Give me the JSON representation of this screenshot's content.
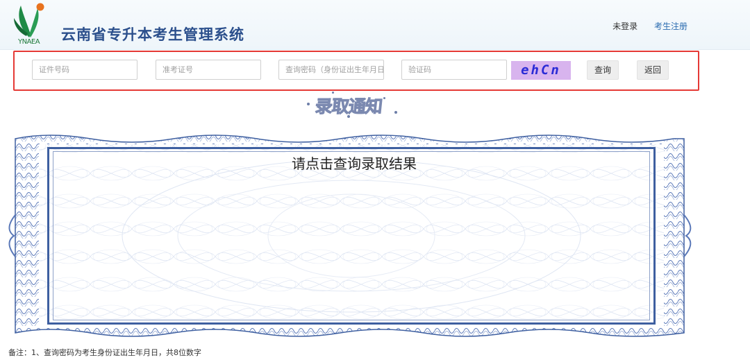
{
  "header": {
    "logo_text": "YNAEA",
    "title": "云南省专升本考生管理系统",
    "links": {
      "login": "未登录",
      "register": "考生注册"
    }
  },
  "search": {
    "id_number_placeholder": "证件号码",
    "admission_ticket_placeholder": "准考证号",
    "password_placeholder": "查询密码（身份证出生年月日）",
    "captcha_placeholder": "验证码",
    "captcha_image_text": "ehCn",
    "query_button": "查询",
    "back_button": "返回"
  },
  "notice": {
    "heading": "录取通知",
    "result_prompt": "请点击查询录取结果"
  },
  "footnote": "备注：1、查询密码为考生身份证出生年月日，共8位数字",
  "colors": {
    "title": "#2b4f8c",
    "highlight_border": "#e53935",
    "captcha_bg": "#d8b4ee",
    "captcha_text": "#2a2bd6",
    "frame": "#3e5fa0"
  }
}
